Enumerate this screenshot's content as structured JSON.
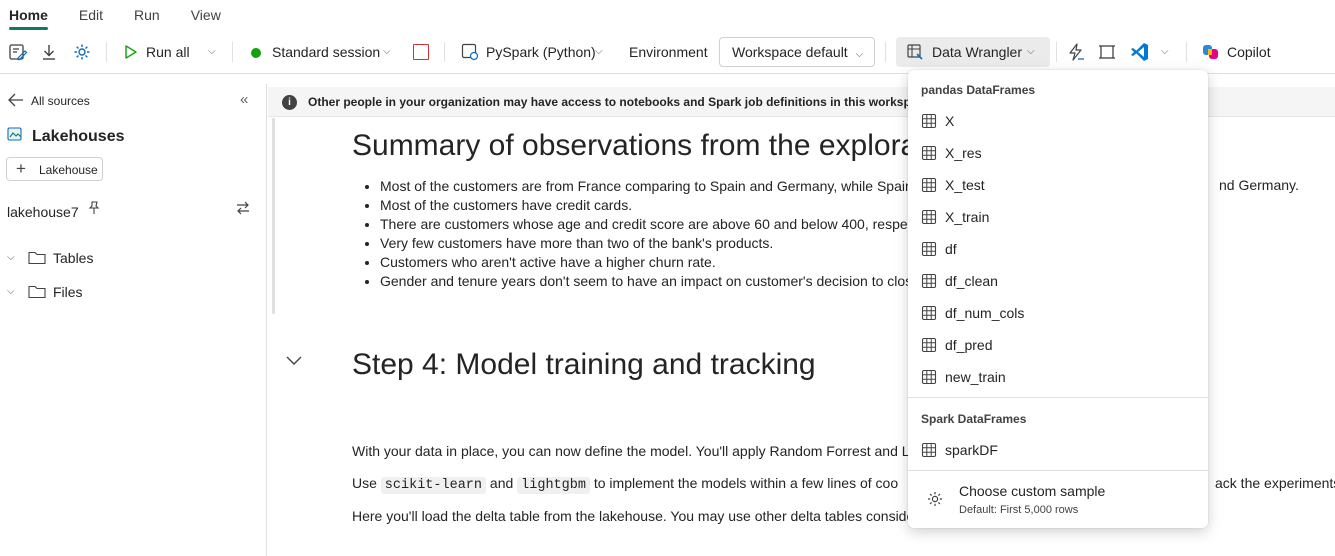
{
  "tabs": [
    "Home",
    "Edit",
    "Run",
    "View"
  ],
  "toolbar": {
    "run_all": "Run all",
    "session": "Standard session",
    "language": "PySpark (Python)",
    "environment_label": "Environment",
    "environment_value": "Workspace default",
    "data_wrangler": "Data Wrangler",
    "copilot": "Copilot"
  },
  "sidebar": {
    "back": "All sources",
    "title": "Lakehouses",
    "add_button": "Lakehouse",
    "lakehouse_name": "lakehouse7",
    "tree": [
      "Tables",
      "Files"
    ]
  },
  "info_bar": "Other people in your organization may have access to notebooks and Spark job definitions in this workspace",
  "notebook": {
    "heading1": "Summary of observations from the exploratory",
    "bullets": [
      "Most of the customers are from France comparing to Spain and Germany, while Spain",
      "Most of the customers have credit cards.",
      "There are customers whose age and credit score are above 60 and below 400, respect",
      "Very few customers have more than two of the bank's products.",
      "Customers who aren't active have a higher churn rate.",
      "Gender and tenure years don't seem to have an impact on customer's decision to clos"
    ],
    "bullet1_tail": "nd Germany.",
    "heading2": "Step 4: Model training and tracking",
    "para1": "With your data in place, you can now define the model. You'll apply Random Forrest and L",
    "para2_pre": "Use",
    "code1": "scikit-learn",
    "para2_mid": "and",
    "code2": "lightgbm",
    "para2_post": "to implement the models within a few lines of coo",
    "para2_tail": "ack the experiments.",
    "para3": "Here you'll load the delta table from the lakehouse. You may use other delta tables conside"
  },
  "menu": {
    "pandas_header": "pandas DataFrames",
    "pandas_items": [
      "X",
      "X_res",
      "X_test",
      "X_train",
      "df",
      "df_clean",
      "df_num_cols",
      "df_pred",
      "new_train"
    ],
    "spark_header": "Spark DataFrames",
    "spark_items": [
      "sparkDF"
    ],
    "custom_title": "Choose custom sample",
    "custom_sub": "Default: First 5,000 rows"
  },
  "colors": {
    "accent": "#117865",
    "run_green": "#13a10e",
    "stop_red": "#d13438",
    "vscode_blue": "#0078d4"
  }
}
